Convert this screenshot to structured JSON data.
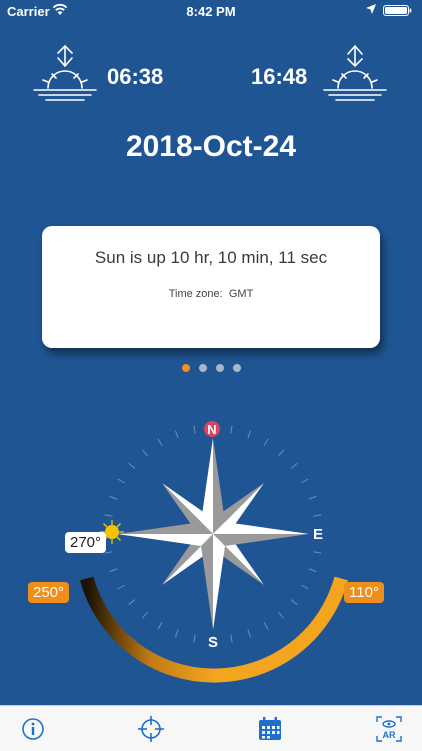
{
  "status_bar": {
    "carrier": "Carrier",
    "time": "8:42 PM"
  },
  "sun": {
    "sunrise_time": "06:38",
    "sunset_time": "16:48"
  },
  "date": "2018-Oct-24",
  "card": {
    "main_text": "Sun is up 10 hr, 10 min, 11 sec",
    "timezone_label": "Time zone:",
    "timezone_value": "GMT"
  },
  "pager": {
    "count": 4,
    "active_index": 0
  },
  "compass": {
    "cardinals": {
      "north": "N",
      "east": "E",
      "south": "S"
    },
    "sunrise_azimuth_label": "110°",
    "sunset_azimuth_label": "250°",
    "sun_azimuth_label": "270°"
  },
  "colors": {
    "background": "#1f5593",
    "accent_orange": "#f0901a",
    "north_marker": "#e0435f",
    "tab_icon": "#1e6fce"
  },
  "tab_bar": {
    "icons": [
      "info-icon",
      "crosshair-icon",
      "calendar-icon",
      "ar-view-icon"
    ],
    "ar_label": "AR"
  }
}
